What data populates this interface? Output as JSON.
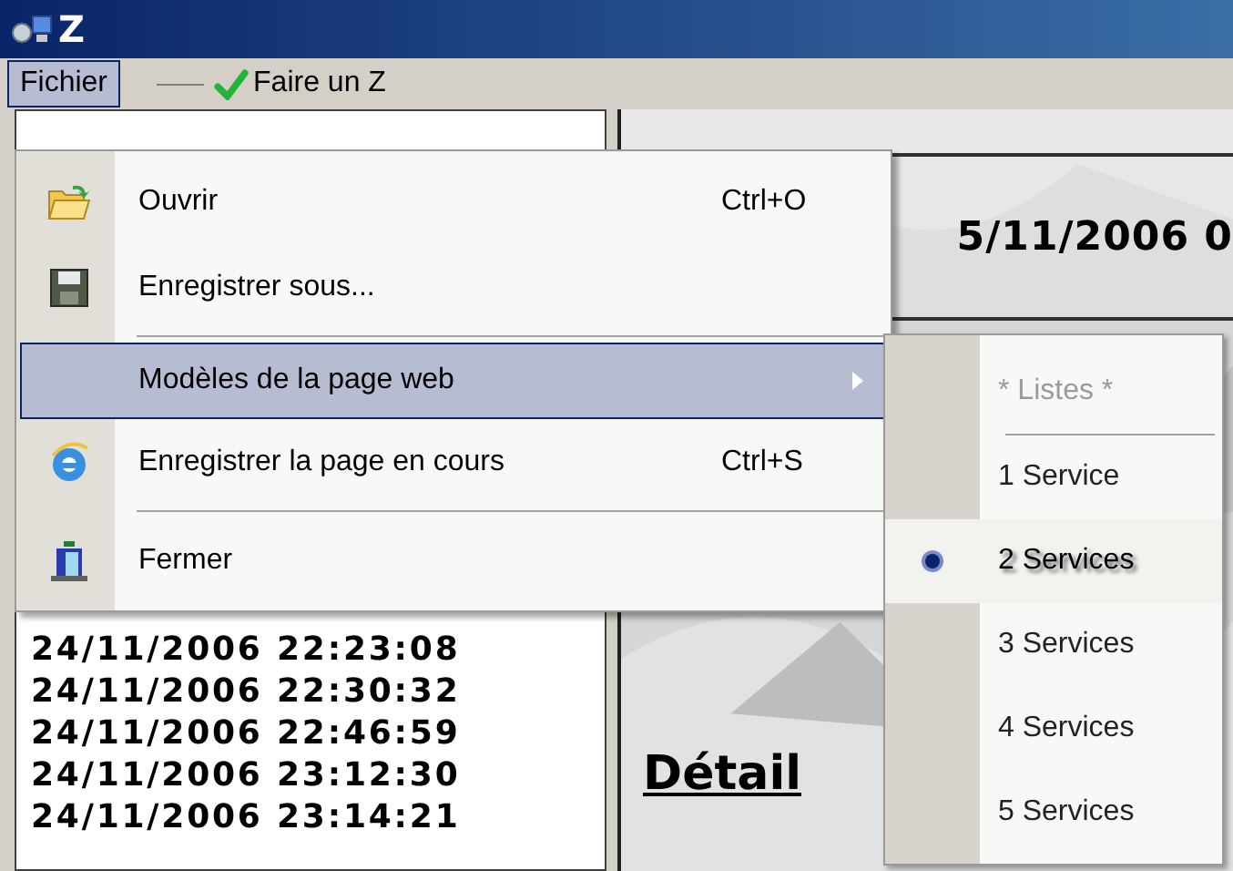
{
  "window": {
    "title": "Z"
  },
  "menubar": [
    {
      "kind": "menu",
      "label": "Fichier",
      "selected": true
    },
    {
      "kind": "tool",
      "label": "Faire un Z",
      "selected": false
    }
  ],
  "file_menu": [
    {
      "kind": "item",
      "label": "Ouvrir",
      "shortcut": "Ctrl+O",
      "selected": false
    },
    {
      "kind": "item",
      "label": "Enregistrer sous...",
      "selected": false
    },
    {
      "kind": "separator"
    },
    {
      "kind": "submenu",
      "label": "Modèles de la page web",
      "selected": true
    },
    {
      "kind": "item",
      "label": "Enregistrer la page en cours",
      "shortcut": "Ctrl+S",
      "selected": false
    },
    {
      "kind": "separator"
    },
    {
      "kind": "item",
      "label": "Fermer",
      "selected": false
    }
  ],
  "submenu": [
    {
      "kind": "heading",
      "label": "* Listes *",
      "disabled": true
    },
    {
      "kind": "separator"
    },
    {
      "kind": "option",
      "label": "1 Service",
      "selected": false
    },
    {
      "kind": "option",
      "label": "2 Services",
      "selected": true
    },
    {
      "kind": "option",
      "label": "3 Services",
      "selected": false
    },
    {
      "kind": "option",
      "label": "4 Services",
      "selected": false
    },
    {
      "kind": "option",
      "label": "5 Services",
      "selected": false
    }
  ],
  "dates": [
    "24/11/2006 22:23:08",
    "24/11/2006 22:30:32",
    "24/11/2006 22:46:59",
    "24/11/2006 23:12:30",
    "24/11/2006 23:14:21"
  ],
  "header_date": "5/11/2006 0",
  "detail_title": "Détail"
}
